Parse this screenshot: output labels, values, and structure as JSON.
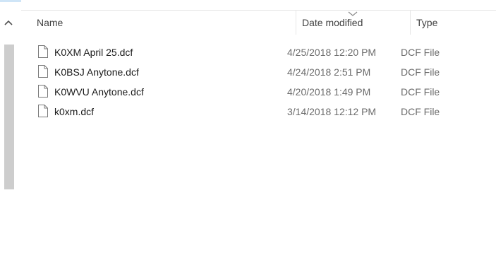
{
  "columns": {
    "name": "Name",
    "date_modified": "Date modified",
    "type": "Type"
  },
  "sort": {
    "column": "date_modified",
    "direction": "descending"
  },
  "files": [
    {
      "name": "K0XM April 25.dcf",
      "date_modified": "4/25/2018 12:20 PM",
      "type": "DCF File",
      "icon": "file-icon"
    },
    {
      "name": "K0BSJ Anytone.dcf",
      "date_modified": "4/24/2018 2:51 PM",
      "type": "DCF File",
      "icon": "file-icon"
    },
    {
      "name": "K0WVU Anytone.dcf",
      "date_modified": "4/20/2018 1:49 PM",
      "type": "DCF File",
      "icon": "file-icon"
    },
    {
      "name": "k0xm.dcf",
      "date_modified": "3/14/2018 12:12 PM",
      "type": "DCF File",
      "icon": "file-icon"
    }
  ],
  "colors": {
    "scroll_thumb": "#cdcdcd",
    "header_text": "#3f3f3f",
    "secondary_text": "#6b6b6b"
  }
}
